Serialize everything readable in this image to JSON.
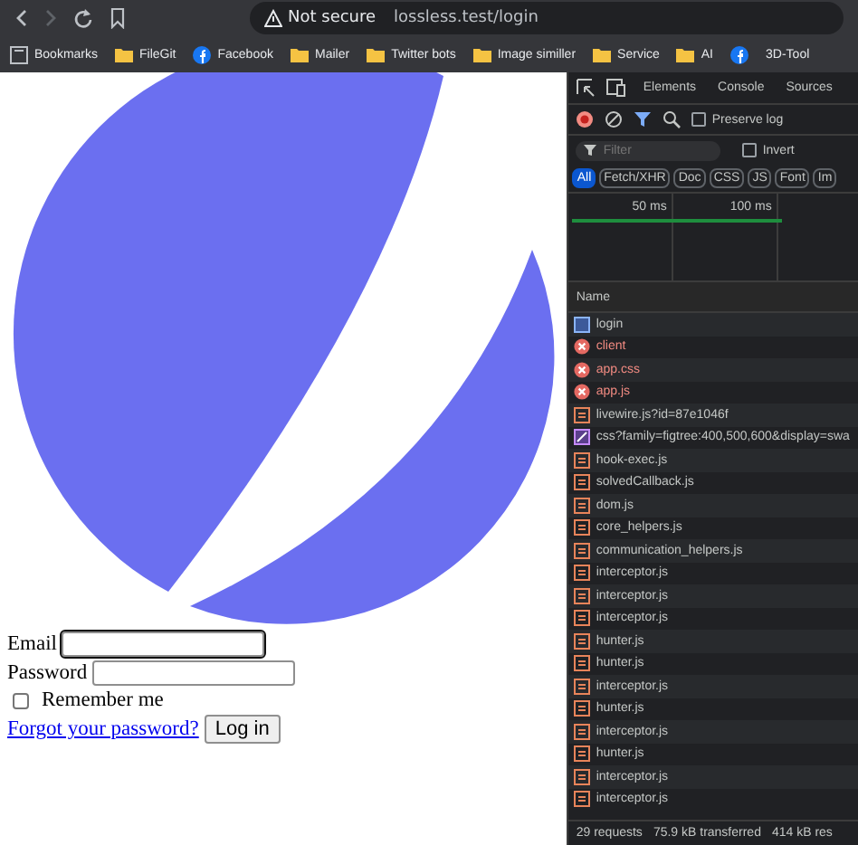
{
  "browser": {
    "address": {
      "security": "Not secure",
      "url": "lossless.test/login"
    },
    "bookmarks": [
      {
        "kind": "bookmarks",
        "label": "Bookmarks"
      },
      {
        "kind": "folder",
        "label": "FileGit"
      },
      {
        "kind": "facebook",
        "label": "Facebook"
      },
      {
        "kind": "folder",
        "label": "Mailer"
      },
      {
        "kind": "folder",
        "label": "Twitter bots"
      },
      {
        "kind": "folder",
        "label": "Image similler"
      },
      {
        "kind": "folder",
        "label": "Service"
      },
      {
        "kind": "folder",
        "label": "AI"
      },
      {
        "kind": "facebook"
      },
      {
        "kind": "plain",
        "label": "3D-Tool"
      }
    ]
  },
  "login_form": {
    "email_label": "Email",
    "password_label": "Password",
    "remember": {
      "label": "Remember me",
      "checked": false
    },
    "forgot_link": "Forgot your password?",
    "submit": "Log in"
  },
  "devtools": {
    "tabs": [
      {
        "label": "Elements",
        "selected": false
      },
      {
        "label": "Console",
        "selected": false
      },
      {
        "label": "Sources",
        "selected": false
      }
    ],
    "preserve_log": {
      "label": "Preserve log",
      "checked": false
    },
    "filter": {
      "placeholder": "Filter"
    },
    "invert": {
      "label": "Invert",
      "checked": false
    },
    "types": [
      {
        "label": "All",
        "selected": true
      },
      {
        "label": "Fetch/XHR",
        "selected": false
      },
      {
        "label": "Doc",
        "selected": false
      },
      {
        "label": "CSS",
        "selected": false
      },
      {
        "label": "JS",
        "selected": false
      },
      {
        "label": "Font",
        "selected": false
      },
      {
        "label": "Im",
        "selected": false
      }
    ],
    "timeline": {
      "ticks": [
        "50 ms",
        "100 ms"
      ]
    },
    "name_header": "Name",
    "requests": [
      {
        "kind": "doc",
        "name": "login"
      },
      {
        "kind": "error",
        "name": "client"
      },
      {
        "kind": "error",
        "name": "app.css"
      },
      {
        "kind": "error",
        "name": "app.js"
      },
      {
        "kind": "script",
        "name": "livewire.js?id=87e1046f"
      },
      {
        "kind": "font",
        "name": "css?family=figtree:400,500,600&display=swa"
      },
      {
        "kind": "script",
        "name": "hook-exec.js"
      },
      {
        "kind": "script",
        "name": "solvedCallback.js"
      },
      {
        "kind": "script",
        "name": "dom.js"
      },
      {
        "kind": "script",
        "name": "core_helpers.js"
      },
      {
        "kind": "script",
        "name": "communication_helpers.js"
      },
      {
        "kind": "script",
        "name": "interceptor.js"
      },
      {
        "kind": "script",
        "name": "interceptor.js"
      },
      {
        "kind": "script",
        "name": "interceptor.js"
      },
      {
        "kind": "script",
        "name": "hunter.js"
      },
      {
        "kind": "script",
        "name": "hunter.js"
      },
      {
        "kind": "script",
        "name": "interceptor.js"
      },
      {
        "kind": "script",
        "name": "hunter.js"
      },
      {
        "kind": "script",
        "name": "interceptor.js"
      },
      {
        "kind": "script",
        "name": "hunter.js"
      },
      {
        "kind": "script",
        "name": "interceptor.js"
      },
      {
        "kind": "script",
        "name": "interceptor.js"
      }
    ],
    "status": [
      "29 requests",
      "75.9 kB transferred",
      "414 kB res"
    ]
  }
}
